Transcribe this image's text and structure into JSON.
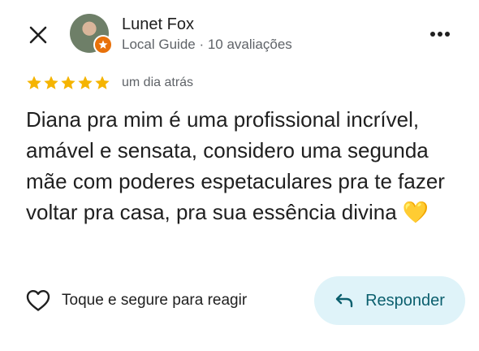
{
  "header": {
    "user_name": "Lunet Fox",
    "user_meta": "Local Guide · 10 avaliações"
  },
  "review": {
    "rating": 5,
    "max_rating": 5,
    "timestamp": "um dia atrás",
    "text": "Diana pra mim é uma profissional incrível, amável e sensata, considero uma segunda mãe com poderes espetaculares pra te fazer voltar pra casa, pra sua essência divina 💛"
  },
  "actions": {
    "react_label": "Toque e segure para reagir",
    "reply_label": "Responder"
  },
  "icons": {
    "close": "close-icon",
    "more": "more-horizontal-icon",
    "star": "star-icon",
    "heart": "heart-outline-icon",
    "reply": "reply-arrow-icon",
    "local_guide_badge": "local-guide-badge-icon"
  },
  "colors": {
    "star": "#f5b400",
    "badge": "#e8710a",
    "reply_bg": "#dff3f9",
    "reply_text": "#0b5f6e",
    "meta_text": "#5f6368"
  }
}
